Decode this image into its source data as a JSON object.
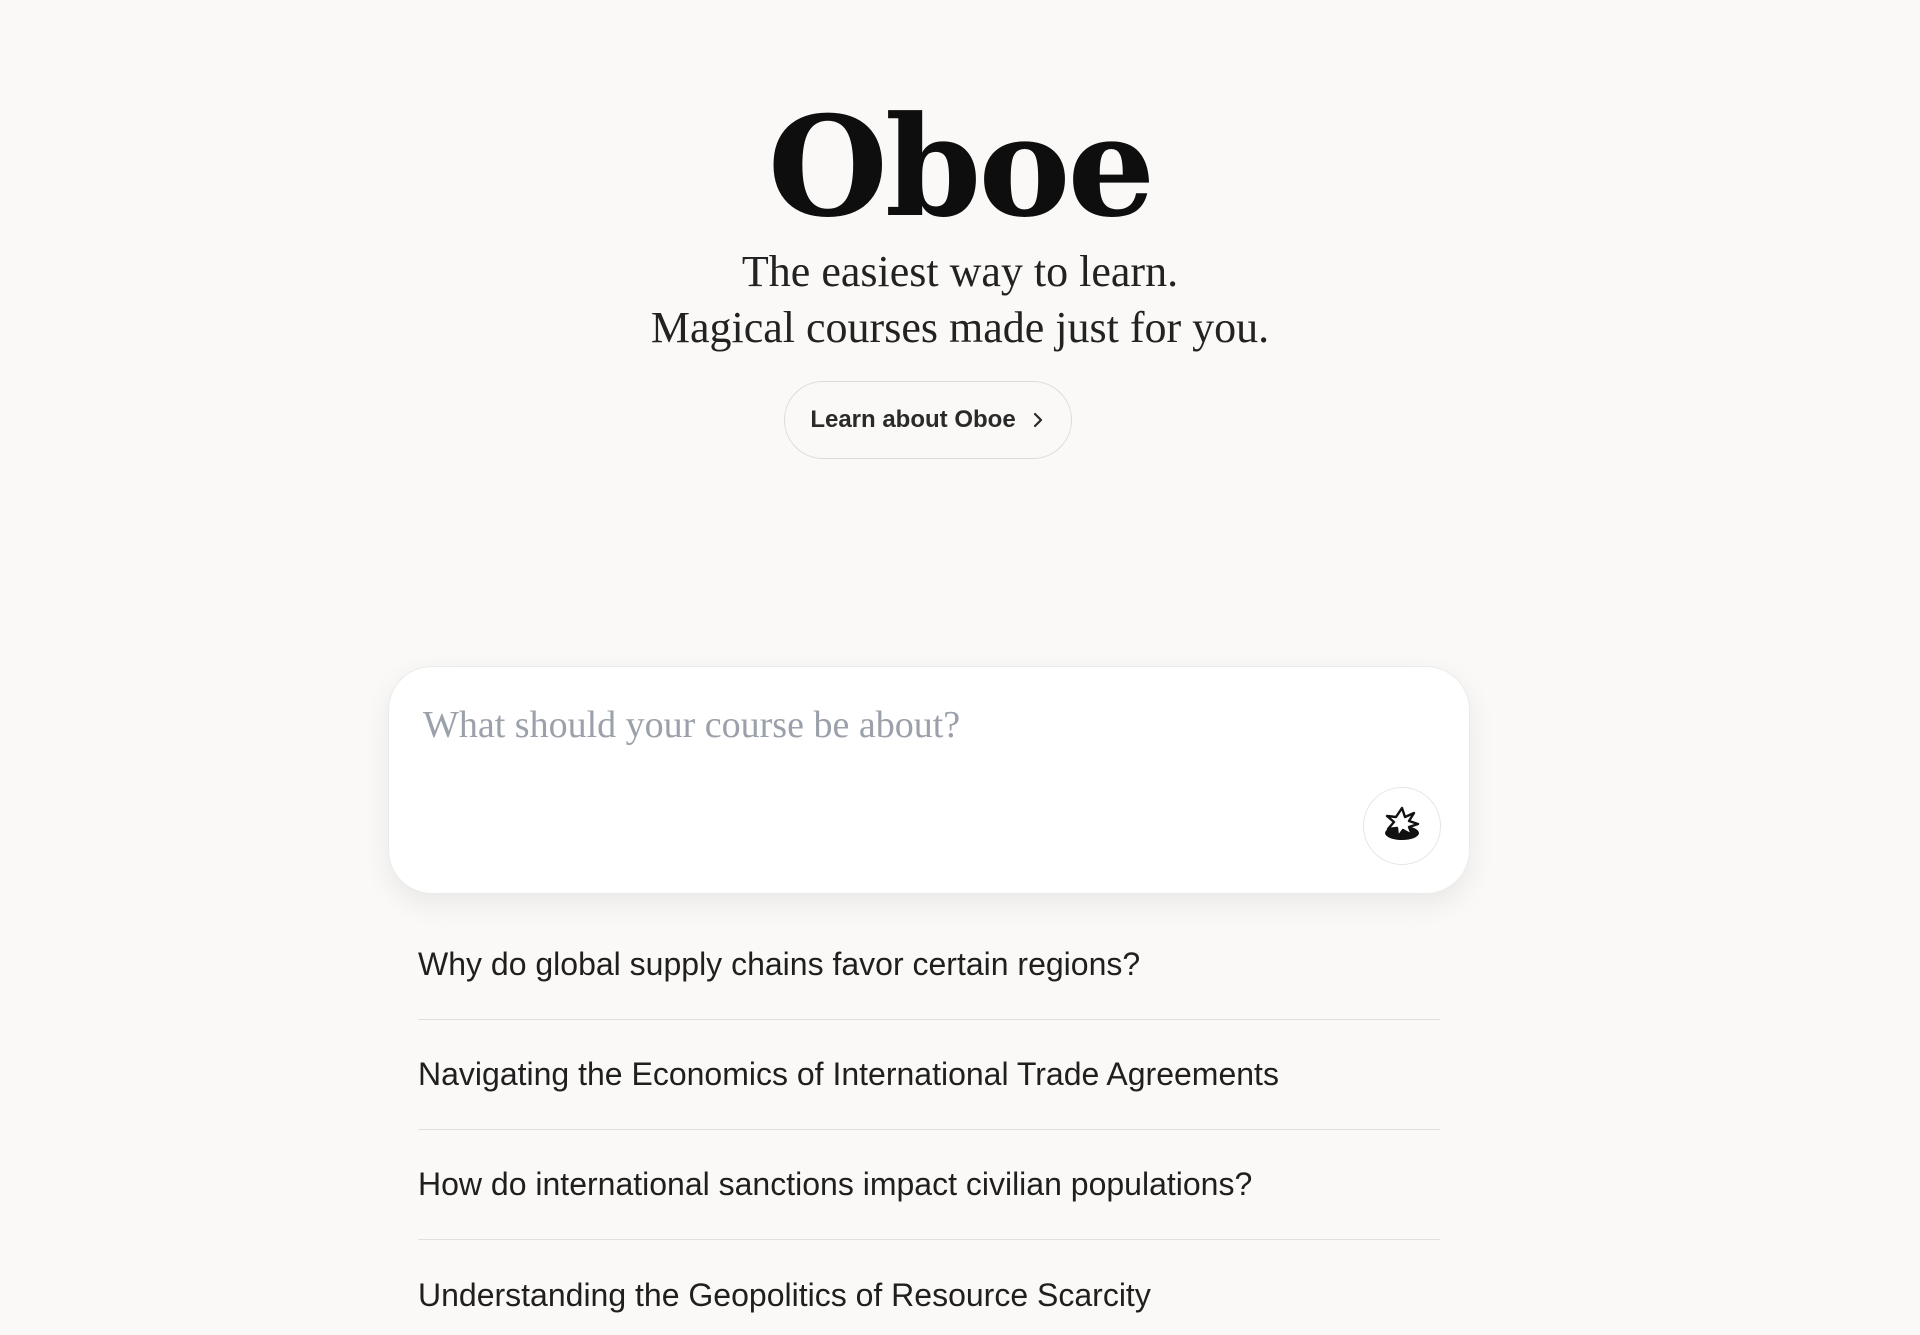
{
  "brand": {
    "logo_text": "Oboe"
  },
  "hero": {
    "tagline_line1": "The easiest way to learn.",
    "tagline_line2": "Magical courses made just for you.",
    "learn_button_label": "Learn about Oboe"
  },
  "course_input": {
    "placeholder": "What should your course be about?",
    "value": ""
  },
  "suggestions": [
    "Why do global supply chains favor certain regions?",
    "Navigating the Economics of International Trade Agreements",
    "How do international sanctions impact civilian populations?",
    "Understanding the Geopolitics of Resource Scarcity"
  ],
  "icons": {
    "learn_button": "chevron-right-icon",
    "generate_button": "magic-sparkle-icon"
  },
  "colors": {
    "background": "#faf9f7",
    "text": "#1e1e1e",
    "placeholder": "#9ba1ab",
    "divider": "#e2e0dc"
  }
}
